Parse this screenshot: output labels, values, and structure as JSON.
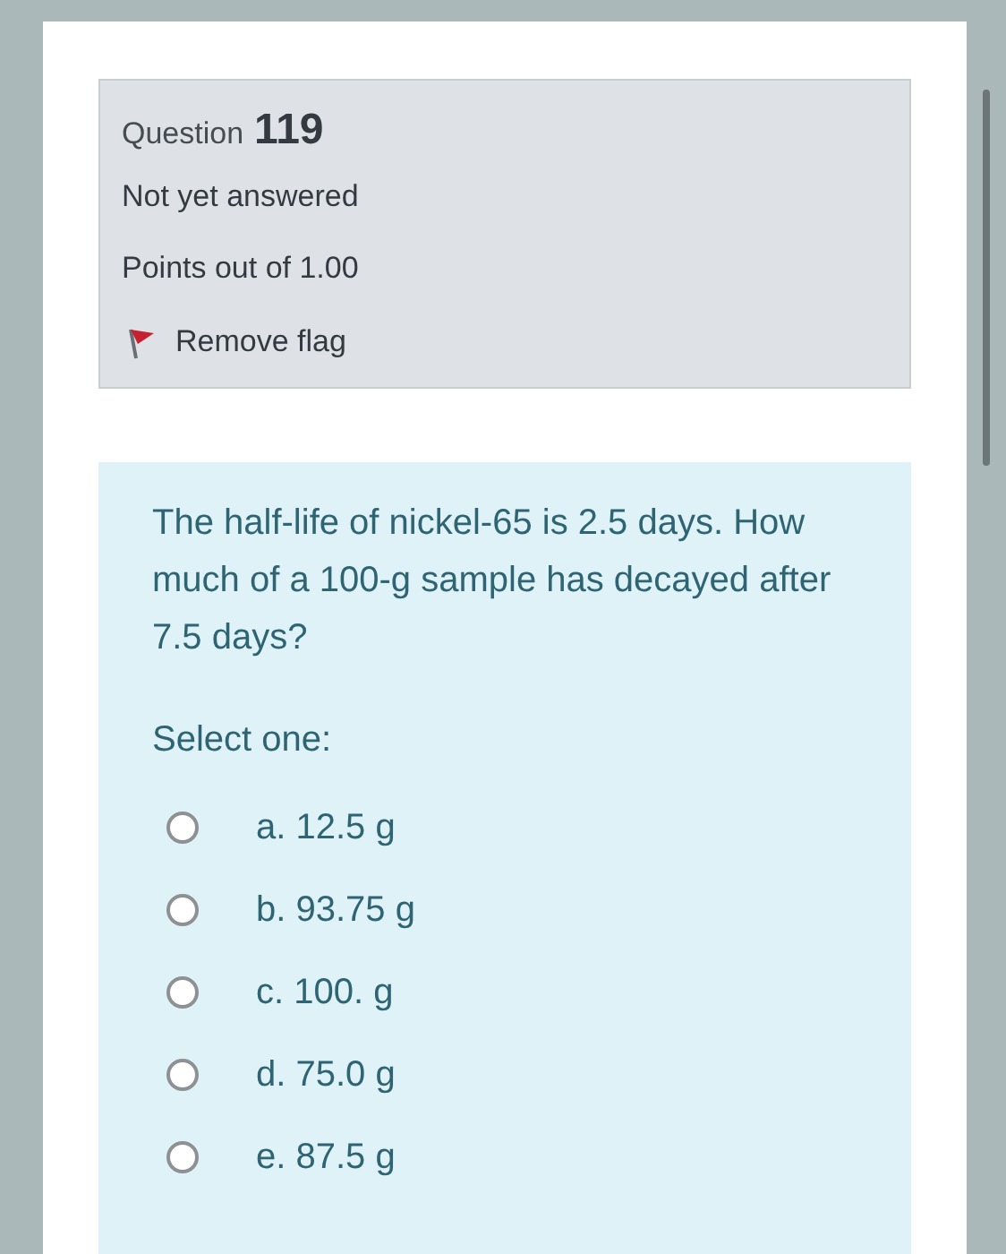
{
  "info": {
    "question_label": "Question",
    "question_number": "119",
    "status": "Not yet answered",
    "points": "Points out of 1.00",
    "flag_action": "Remove flag",
    "flagged": true
  },
  "question": {
    "text": "The half-life of nickel-65 is 2.5 days. How much of a 100-g sample has decayed after 7.5 days?",
    "prompt": "Select one:",
    "options": [
      {
        "label": "a. 12.5 g",
        "selected": false
      },
      {
        "label": "b. 93.75 g",
        "selected": false
      },
      {
        "label": "c. 100. g",
        "selected": false
      },
      {
        "label": "d. 75.0 g",
        "selected": false
      },
      {
        "label": "e. 87.5 g",
        "selected": false
      }
    ]
  }
}
